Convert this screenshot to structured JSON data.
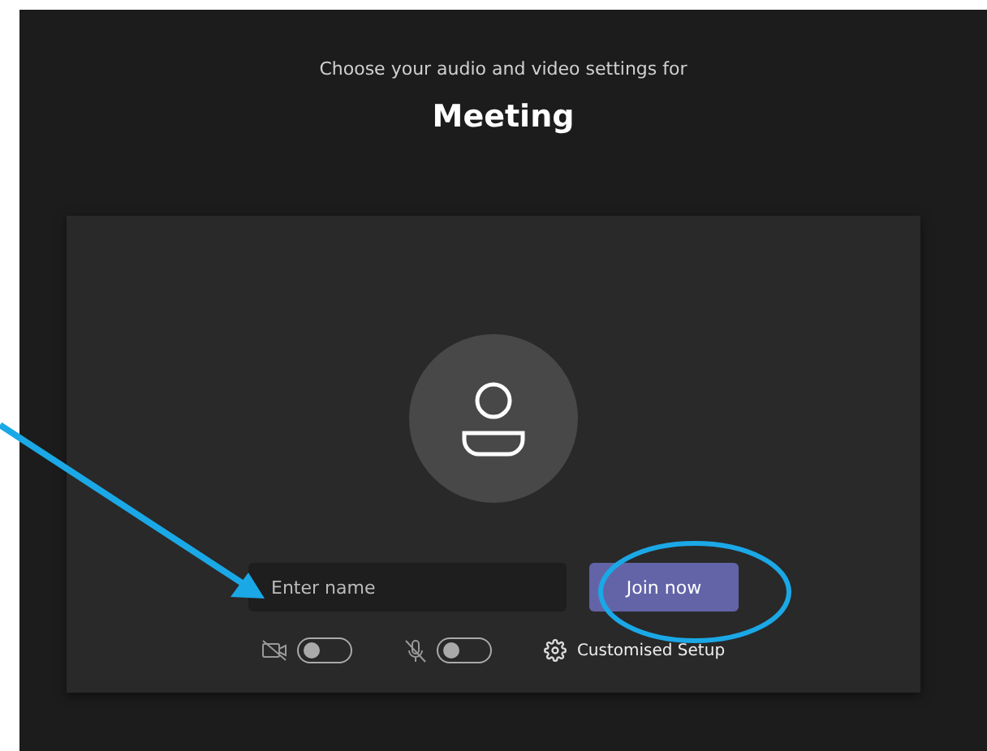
{
  "header": {
    "subtitle": "Choose your audio and video settings for",
    "title": "Meeting"
  },
  "name_field": {
    "placeholder": "Enter name"
  },
  "join_button": {
    "label": "Join now"
  },
  "toggles": [
    {
      "kind": "camera",
      "on": false
    },
    {
      "kind": "microphone",
      "on": false
    }
  ],
  "setup_link": {
    "label": "Customised Setup"
  }
}
